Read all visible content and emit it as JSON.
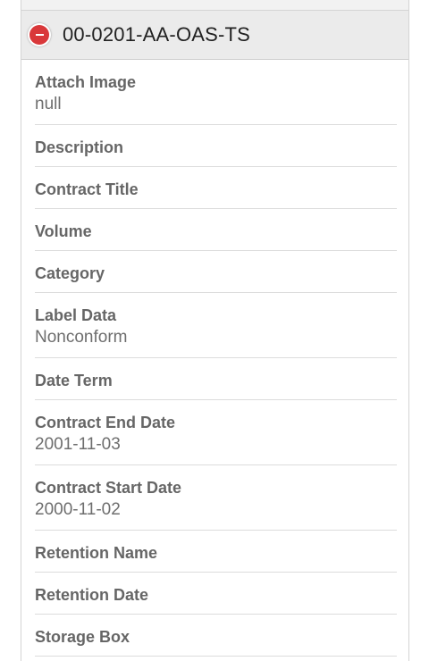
{
  "record": {
    "title": "00-0201-AA-OAS-TS"
  },
  "fields": [
    {
      "label": "Attach Image",
      "value": "null"
    },
    {
      "label": "Description",
      "value": ""
    },
    {
      "label": "Contract Title",
      "value": ""
    },
    {
      "label": "Volume",
      "value": ""
    },
    {
      "label": "Category",
      "value": ""
    },
    {
      "label": "Label Data",
      "value": "Nonconform"
    },
    {
      "label": "Date Term",
      "value": ""
    },
    {
      "label": "Contract End Date",
      "value": "2001-11-03"
    },
    {
      "label": "Contract Start Date",
      "value": "2000-11-02"
    },
    {
      "label": "Retention Name",
      "value": ""
    },
    {
      "label": "Retention Date",
      "value": ""
    },
    {
      "label": "Storage Box",
      "value": ""
    }
  ],
  "colors": {
    "collapse_button": "#d9383a",
    "header_background": "#ebebeb"
  }
}
